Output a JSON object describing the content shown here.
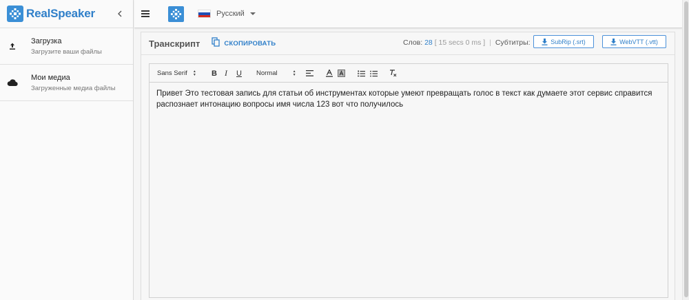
{
  "app": {
    "name": "RealSpeaker",
    "brand_color": "#2f7fc9"
  },
  "sidebar": {
    "collapse_icon": "chevron-left-icon",
    "items": [
      {
        "icon": "upload-icon",
        "title": "Загрузка",
        "subtitle": "Загрузите ваши файлы"
      },
      {
        "icon": "cloud-icon",
        "title": "Мои медиа",
        "subtitle": "Загруженные медиа файлы"
      }
    ]
  },
  "topbar": {
    "menu_icon": "hamburger-menu-icon",
    "language": {
      "label": "Русский",
      "flag_colors": [
        "#ffffff",
        "#1f4fb4",
        "#d52b1e"
      ]
    }
  },
  "transcript": {
    "title": "Транскрипт",
    "copy_label": "СКОПИРОВАТЬ",
    "words_label": "Слов:",
    "words_count": "28",
    "duration": "[ 15 secs 0 ms ]",
    "subtitles_label": "Субтитры:",
    "srt_label": "SubRip (.srt)",
    "vtt_label": "WebVTT (.vtt)"
  },
  "editor": {
    "font_picker": "Sans Serif",
    "size_picker": "Normal",
    "toolbar_icons": [
      "bold-icon",
      "italic-icon",
      "underline-icon",
      "align-icon",
      "text-color-icon",
      "background-color-icon",
      "ordered-list-icon",
      "bullet-list-icon",
      "clear-format-icon"
    ],
    "bold_glyph": "B",
    "italic_glyph": "I",
    "underline_glyph": "U",
    "content": "Привет Это тестовая запись для статьи об инструментах которые умеют превращать голос в текст как думаете этот сервис справится распознает интонацию вопросы имя числа 123 вот что получилось"
  }
}
